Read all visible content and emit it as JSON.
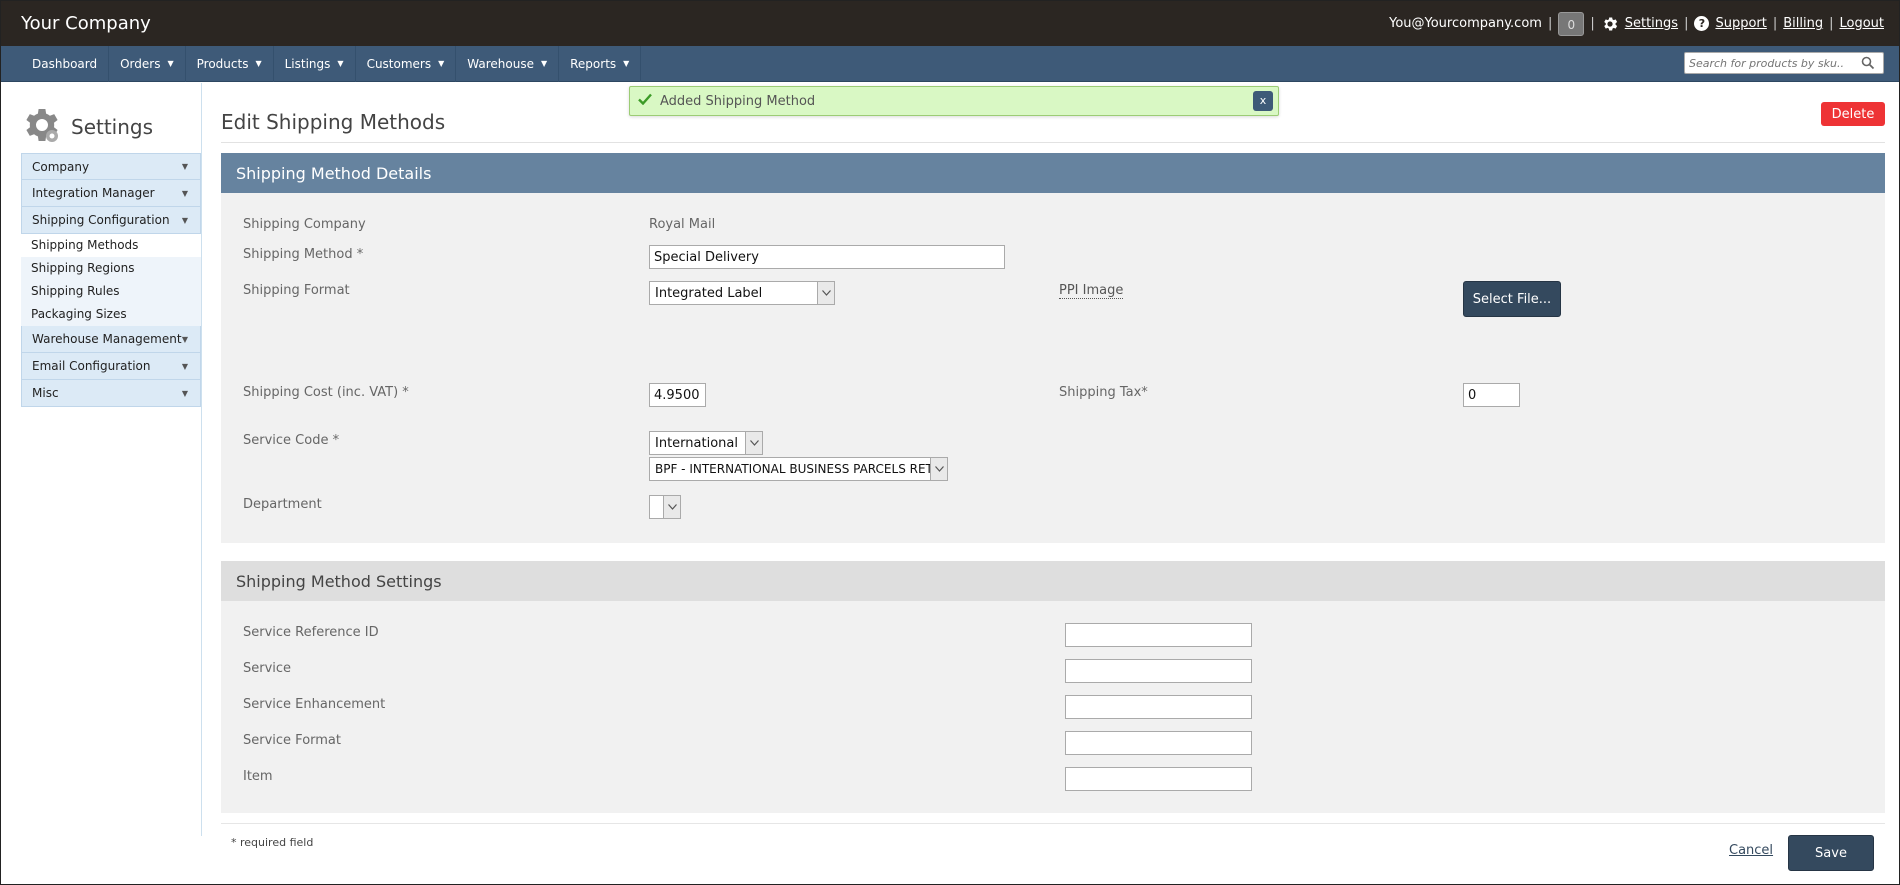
{
  "header": {
    "brand": "Your Company",
    "email": "You@Yourcompany.com",
    "notifications_count": "0",
    "settings": "Settings",
    "support": "Support",
    "billing": "Billing",
    "logout": "Logout",
    "sep": "|"
  },
  "nav": {
    "items": [
      "Dashboard",
      "Orders",
      "Products",
      "Listings",
      "Customers",
      "Warehouse",
      "Reports"
    ],
    "caret": "▼",
    "search_placeholder": "Search for products by sku.."
  },
  "sidebar": {
    "title": "Settings",
    "caret": "▼",
    "sections": [
      "Company",
      "Integration Manager",
      "Shipping Configuration",
      "Warehouse Management",
      "Email Configuration",
      "Misc"
    ],
    "sub_items": [
      "Shipping Methods",
      "Shipping Regions",
      "Shipping Rules",
      "Packaging Sizes"
    ]
  },
  "alert": {
    "message": "Added Shipping Method",
    "close": "x"
  },
  "page": {
    "title": "Edit Shipping Methods",
    "delete": "Delete"
  },
  "details": {
    "heading": "Shipping Method Details",
    "shipping_company_label": "Shipping Company",
    "shipping_company_value": "Royal Mail",
    "shipping_method_label": "Shipping Method *",
    "shipping_method_value": "Special Delivery",
    "shipping_format_label": "Shipping Format",
    "shipping_format_value": "Integrated Label",
    "ppi_label": "PPI Image",
    "select_file": "Select File...",
    "shipping_cost_label": "Shipping Cost (inc. VAT) *",
    "shipping_cost_value": "4.9500",
    "shipping_tax_label": "Shipping Tax*",
    "shipping_tax_value": "0",
    "service_code_label": "Service Code *",
    "service_code_value": "International",
    "service_code_detail": "BPF - INTERNATIONAL BUSINESS PARCELS RETURNS",
    "department_label": "Department",
    "department_value": ""
  },
  "settings_panel": {
    "heading": "Shipping Method Settings",
    "fields": [
      {
        "label": "Service Reference ID",
        "value": ""
      },
      {
        "label": "Service",
        "value": ""
      },
      {
        "label": "Service Enhancement",
        "value": ""
      },
      {
        "label": "Service Format",
        "value": ""
      },
      {
        "label": "Item",
        "value": ""
      }
    ]
  },
  "footer": {
    "required_note": "* required field",
    "cancel": "Cancel",
    "save": "Save"
  }
}
